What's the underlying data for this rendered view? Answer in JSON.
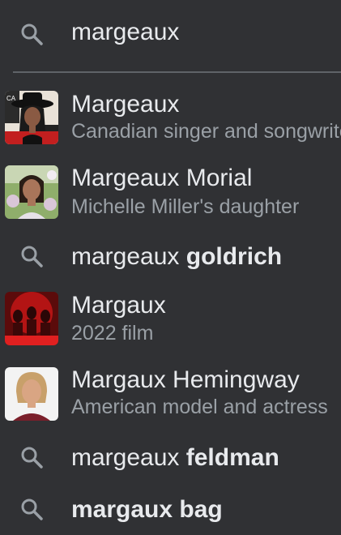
{
  "search": {
    "query": "margeaux",
    "icon": "search-icon"
  },
  "colors": {
    "background": "#303134",
    "primary_text": "#e8eaed",
    "secondary_text": "#9aa0a6",
    "icon": "#9aa0a6",
    "divider": "#5f6368"
  },
  "suggestions": [
    {
      "type": "entity",
      "title": "Margeaux",
      "subtitle": "Canadian singer and songwriter",
      "thumb_icon": "person-photo"
    },
    {
      "type": "entity",
      "title": "Margeaux Morial",
      "subtitle": "Michelle Miller's daughter",
      "thumb_icon": "person-photo"
    },
    {
      "type": "query",
      "prefix": "margeaux ",
      "bold": "goldrich",
      "icon": "search-icon"
    },
    {
      "type": "entity",
      "title": "Margaux",
      "subtitle": "2022 film",
      "thumb_icon": "film-poster"
    },
    {
      "type": "entity",
      "title": "Margaux Hemingway",
      "subtitle": "American model and actress",
      "thumb_icon": "person-photo"
    },
    {
      "type": "query",
      "prefix": "margeaux ",
      "bold": "feldman",
      "icon": "search-icon"
    },
    {
      "type": "query",
      "prefix": "",
      "bold": "margaux bag",
      "icon": "search-icon"
    }
  ]
}
